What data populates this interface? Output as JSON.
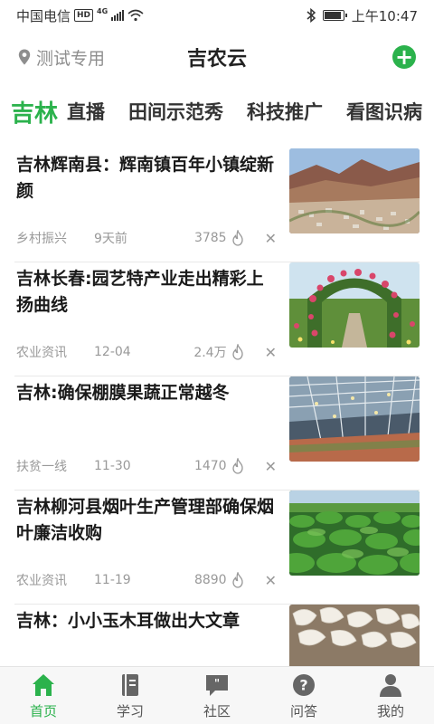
{
  "status_bar": {
    "carrier": "中国电信",
    "hd": "HD",
    "network": "4G",
    "time": "上午10:47"
  },
  "header": {
    "location": "测试专用",
    "title": "吉农云"
  },
  "tabs": [
    {
      "label": "吉林",
      "active": true
    },
    {
      "label": "直播"
    },
    {
      "label": "田间示范秀"
    },
    {
      "label": "科技推广"
    },
    {
      "label": "看图识病"
    }
  ],
  "news": [
    {
      "title": "吉林辉南县：辉南镇百年小镇绽新颜",
      "category": "乡村振兴",
      "date": "9天前",
      "views": "3785",
      "image": "mountain-valley-town"
    },
    {
      "title": "吉林长春:园艺特产业走出精彩上扬曲线",
      "category": "农业资讯",
      "date": "12-04",
      "views": "2.4万",
      "image": "flower-arch-garden"
    },
    {
      "title": "吉林:确保棚膜果蔬正常越冬",
      "category": "扶贫一线",
      "date": "11-30",
      "views": "1470",
      "image": "greenhouse"
    },
    {
      "title": "吉林柳河县烟叶生产管理部确保烟叶廉洁收购",
      "category": "农业资讯",
      "date": "11-19",
      "views": "8890",
      "image": "tobacco-field"
    },
    {
      "title": "吉林：小小玉木耳做出大文章",
      "category": "",
      "date": "",
      "views": "",
      "image": "white-fungus"
    }
  ],
  "bottom_nav": [
    {
      "label": "首页",
      "icon": "home-icon",
      "active": true
    },
    {
      "label": "学习",
      "icon": "book-icon"
    },
    {
      "label": "社区",
      "icon": "chat-icon"
    },
    {
      "label": "问答",
      "icon": "question-icon"
    },
    {
      "label": "我的",
      "icon": "user-icon"
    }
  ],
  "colors": {
    "accent": "#2bb24c",
    "text": "#1a1a1a",
    "muted": "#999999"
  }
}
